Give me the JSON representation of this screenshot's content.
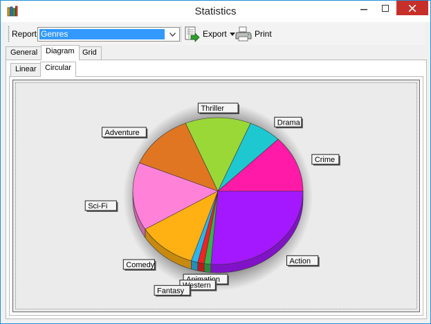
{
  "window": {
    "title": "Statistics"
  },
  "toolbar": {
    "report_label": "Report",
    "report_value": "Genres",
    "export_label": "Export",
    "print_label": "Print"
  },
  "tabs": [
    {
      "label": "General",
      "active": false
    },
    {
      "label": "Diagram",
      "active": true
    },
    {
      "label": "Grid",
      "active": false
    }
  ],
  "subtabs": [
    {
      "label": "Linear",
      "active": false
    },
    {
      "label": "Circular",
      "active": true
    }
  ],
  "icons": {
    "app": "books-icon",
    "export": "export-sheet-icon",
    "print": "printer-icon"
  },
  "chart_data": {
    "type": "pie",
    "style": "3d-pie",
    "categories": [
      "Action",
      "Animation",
      "Western",
      "Fantasy",
      "Comedy",
      "Sci-Fi",
      "Adventure",
      "Thriller",
      "Drama",
      "Crime"
    ],
    "values": [
      25.3,
      1.2,
      1.2,
      1.2,
      10.8,
      14.4,
      12.0,
      12.0,
      6.0,
      12.0
    ],
    "colors": [
      "#a418ff",
      "#3ab14a",
      "#f02222",
      "#2ab6f0",
      "#ffb012",
      "#ff82d8",
      "#e07622",
      "#9ad838",
      "#1ec8d0",
      "#ff1aa8"
    ],
    "title": "",
    "legend": "callout labels around pie"
  }
}
